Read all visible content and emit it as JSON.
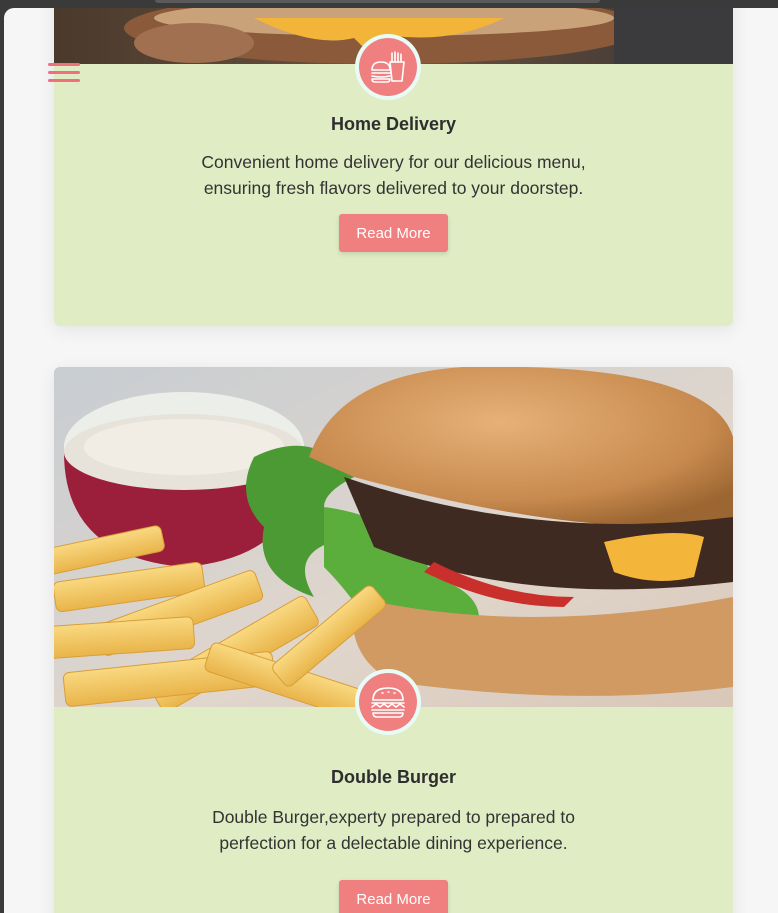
{
  "cards": [
    {
      "title": "Home Delivery",
      "text": "Convenient home delivery for our delicious menu, ensuring fresh flavors delivered to your doorstep.",
      "button_label": "Read More",
      "icon": "burger-fries-icon"
    },
    {
      "title": "Double Burger",
      "text": "Double Burger,experty prepared to prepared to perfection for a delectable dining experience.",
      "button_label": "Read More",
      "icon": "burger-icon"
    }
  ],
  "menu_icon": "hamburger-menu-icon",
  "colors": {
    "accent": "#f08080",
    "card_background": "#dfecc4",
    "badge_ring": "#e8fbf6",
    "menu": "#ef6f7a"
  }
}
